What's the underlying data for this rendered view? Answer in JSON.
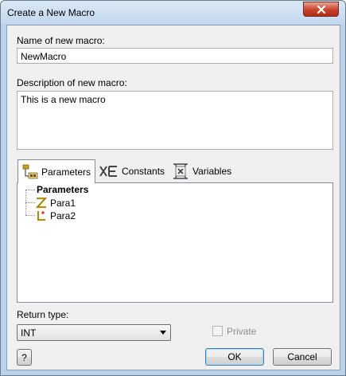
{
  "window": {
    "title": "Create a New Macro",
    "close_icon": "close-icon"
  },
  "form": {
    "name_label": "Name of new macro:",
    "name_value": "NewMacro",
    "description_label": "Description of new macro:",
    "description_value": "This is a new macro"
  },
  "tabs": [
    {
      "label": "Parameters",
      "icon": "parameters-icon",
      "active": true
    },
    {
      "label": "Constants",
      "icon": "constants-icon",
      "active": false
    },
    {
      "label": "Variables",
      "icon": "variables-icon",
      "active": false
    }
  ],
  "tree": {
    "root": "Parameters",
    "items": [
      {
        "label": "Para1",
        "icon": "z-type-icon"
      },
      {
        "label": "Para2",
        "icon": "l-type-icon"
      }
    ]
  },
  "return_type": {
    "label": "Return type:",
    "value": "INT"
  },
  "private_checkbox": {
    "label": "Private",
    "checked": false,
    "enabled": false
  },
  "buttons": {
    "help": "?",
    "ok": "OK",
    "cancel": "Cancel"
  },
  "colors": {
    "frame": "#b9d1ea",
    "client_bg": "#f0f0f0",
    "close_button": "#c7432a",
    "icon_gold": "#c8a21a"
  }
}
